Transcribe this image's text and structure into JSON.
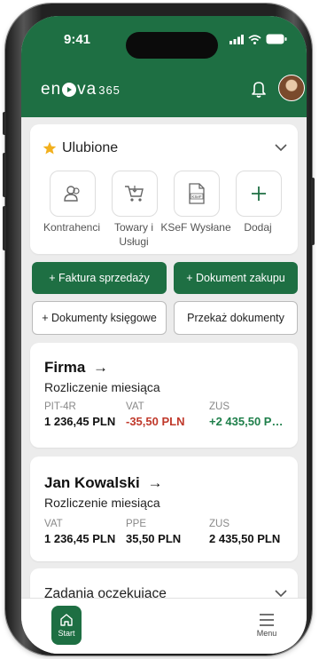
{
  "status": {
    "time": "9:41"
  },
  "header": {
    "brand_left": "en",
    "brand_right": "va",
    "brand_num": "365"
  },
  "favorites": {
    "title": "Ulubione",
    "items": [
      {
        "label": "Kontrahenci",
        "icon": "people-icon"
      },
      {
        "label": "Towary i Usługi",
        "icon": "cart-icon"
      },
      {
        "label": "KSeF Wysłane",
        "icon": "ksef-doc-icon",
        "icon_text": "KSeF"
      },
      {
        "label": "Dodaj",
        "icon": "plus-icon"
      }
    ]
  },
  "actions": {
    "sales_invoice": "+ Faktura sprzedaży",
    "purchase_doc": "+ Dokument zakupu",
    "accounting_docs": "+ Dokumenty księgowe",
    "transfer_docs": "Przekaż dokumenty"
  },
  "company": {
    "title": "Firma",
    "subtitle": "Rozliczenie miesiąca",
    "cols": [
      {
        "label": "PIT-4R",
        "value": "1 236,45 PLN",
        "tone": "default"
      },
      {
        "label": "VAT",
        "value": "-35,50 PLN",
        "tone": "red"
      },
      {
        "label": "ZUS",
        "value": "+2 435,50 P…",
        "tone": "green"
      }
    ]
  },
  "person": {
    "title": "Jan Kowalski",
    "subtitle": "Rozliczenie miesiąca",
    "cols": [
      {
        "label": "VAT",
        "value": "1 236,45 PLN"
      },
      {
        "label": "PPE",
        "value": "35,50 PLN"
      },
      {
        "label": "ZUS",
        "value": "2 435,50 PLN"
      }
    ]
  },
  "tasks": {
    "title": "Zadania oczekujące"
  },
  "tabbar": {
    "start": "Start",
    "menu": "Menu"
  },
  "colors": {
    "brand": "#1e6f43",
    "negative": "#c0392b",
    "positive": "#1e7f4a"
  }
}
